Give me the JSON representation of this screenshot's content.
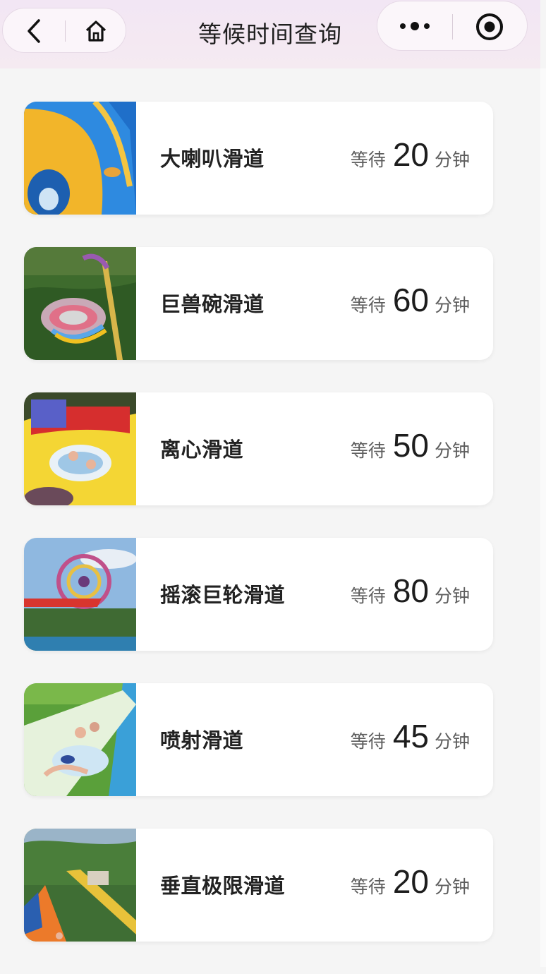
{
  "header": {
    "title": "等候时间查询",
    "icons": [
      "back-icon",
      "home-icon",
      "more-icon",
      "close-target-icon"
    ]
  },
  "wait_prefix": "等待",
  "wait_unit": "分钟",
  "rides": [
    {
      "name": "大喇叭滑道",
      "minutes": "20"
    },
    {
      "name": "巨兽碗滑道",
      "minutes": "60"
    },
    {
      "name": "离心滑道",
      "minutes": "50"
    },
    {
      "name": "摇滚巨轮滑道",
      "minutes": "80"
    },
    {
      "name": "喷射滑道",
      "minutes": "45"
    },
    {
      "name": "垂直极限滑道",
      "minutes": "20"
    }
  ],
  "colors": {
    "background": "#f5f5f5",
    "card": "#ffffff",
    "header": "#f2e6f4"
  }
}
